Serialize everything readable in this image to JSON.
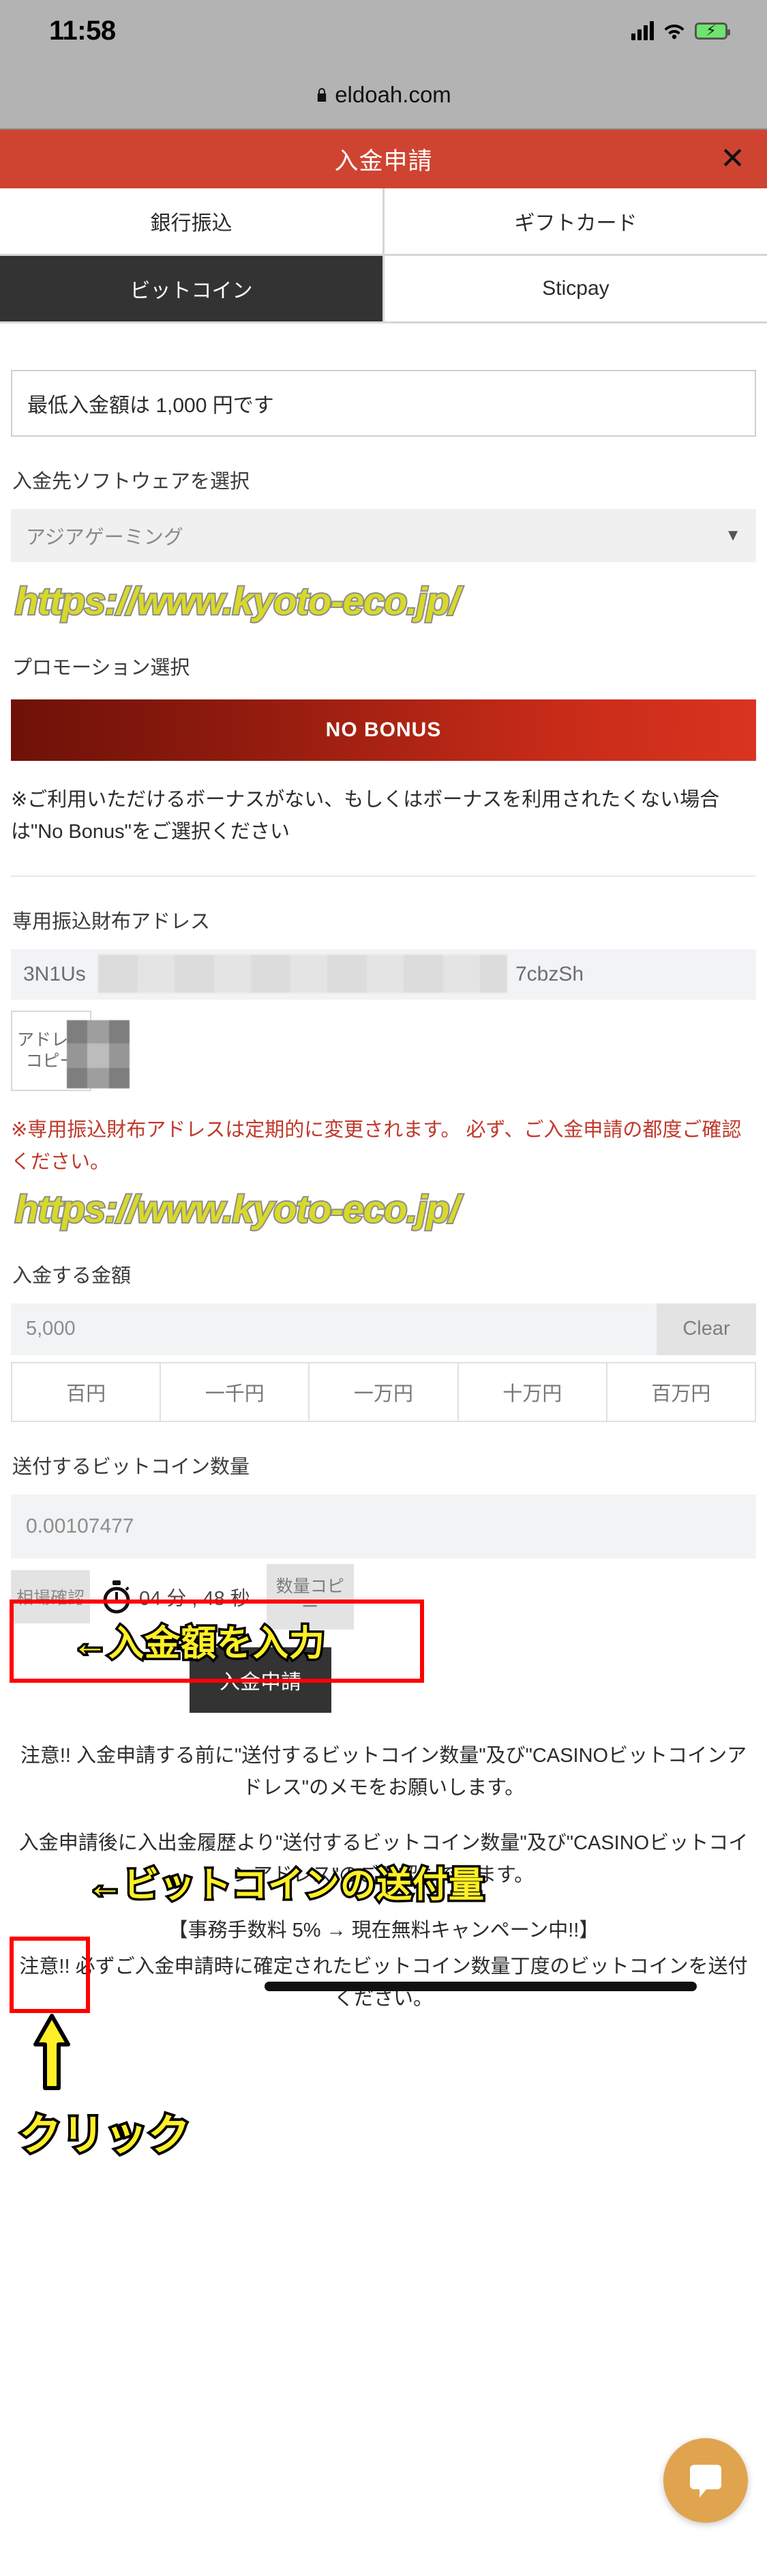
{
  "status_bar": {
    "time": "11:58",
    "signal_icon": "signal-bars-icon",
    "wifi_icon": "wifi-icon",
    "battery_icon": "battery-charging-icon"
  },
  "browser": {
    "lock_icon": "lock-icon",
    "url": "eldoah.com"
  },
  "modal": {
    "title": "入金申請",
    "close_label": "✕"
  },
  "tabs": [
    {
      "label": "銀行振込",
      "active": false
    },
    {
      "label": "ギフトカード",
      "active": false
    },
    {
      "label": "ビットコイン",
      "active": true
    },
    {
      "label": "Sticpay",
      "active": false
    }
  ],
  "form": {
    "min_deposit_notice": "最低入金額は 1,000 円です",
    "software_label": "入金先ソフトウェアを選択",
    "software_value": "アジアゲーミング",
    "software_caret": "▼",
    "promo_label": "プロモーション選択",
    "bonus_button": "NO BONUS",
    "bonus_note": "※ご利用いただけるボーナスがない、もしくはボーナスを利用されたくない場合は\"No Bonus\"をご選択ください",
    "wallet_label": "専用振込財布アドレス",
    "wallet_address_prefix": "3N1Us",
    "wallet_address_suffix": "7cbzSh",
    "copy_address_button": "アドレスコピー",
    "wallet_warning": "※専用振込財布アドレスは定期的に変更されます。 必ず、ご入金申請の都度ご確認ください。",
    "amount_label": "入金する金額",
    "amount_placeholder": "5,000",
    "clear_button": "Clear",
    "quick_amounts": [
      "百円",
      "一千円",
      "一万円",
      "十万円",
      "百万円"
    ],
    "btc_label": "送付するビットコイン数量",
    "btc_amount": "0.00107477",
    "rate_button": "相場確認",
    "stopwatch_icon": "stopwatch-icon",
    "timer": "04 分 , 48 秒",
    "qty_copy_button": "数量コピー",
    "submit_button": "入金申請"
  },
  "footer": {
    "note1": "注意!! 入金申請する前に\"送付するビットコイン数量\"及び\"CASINOビットコインアドレス\"のメモをお願いします。",
    "note2": "入金申請後に入出金履歴より\"送付するビットコイン数量\"及び\"CASINOビットコインアドレス\"のご確認もできます。",
    "note3": "【事務手数料 5% → 現在無料キャンペーン中!!】",
    "note4": "注意!! 必ずご入金申請時に確定されたビットコイン数量丁度のビットコインを送付ください。"
  },
  "watermarks": {
    "url_text": "https://www.kyoto-eco.jp/"
  },
  "annotations": {
    "amount_arrow": "←入金額を入力",
    "btc_arrow": "←ビットコインの送付量",
    "click_label": "クリック"
  },
  "chat": {
    "icon": "chat-bubble-icon"
  },
  "colors": {
    "brand_red": "#cf4431",
    "active_tab": "#333333",
    "annotation_red": "#ff0000",
    "annotation_yellow": "#ffef26",
    "watermark_yellow": "#d8d92a",
    "chat_orange": "#e0a44f"
  }
}
